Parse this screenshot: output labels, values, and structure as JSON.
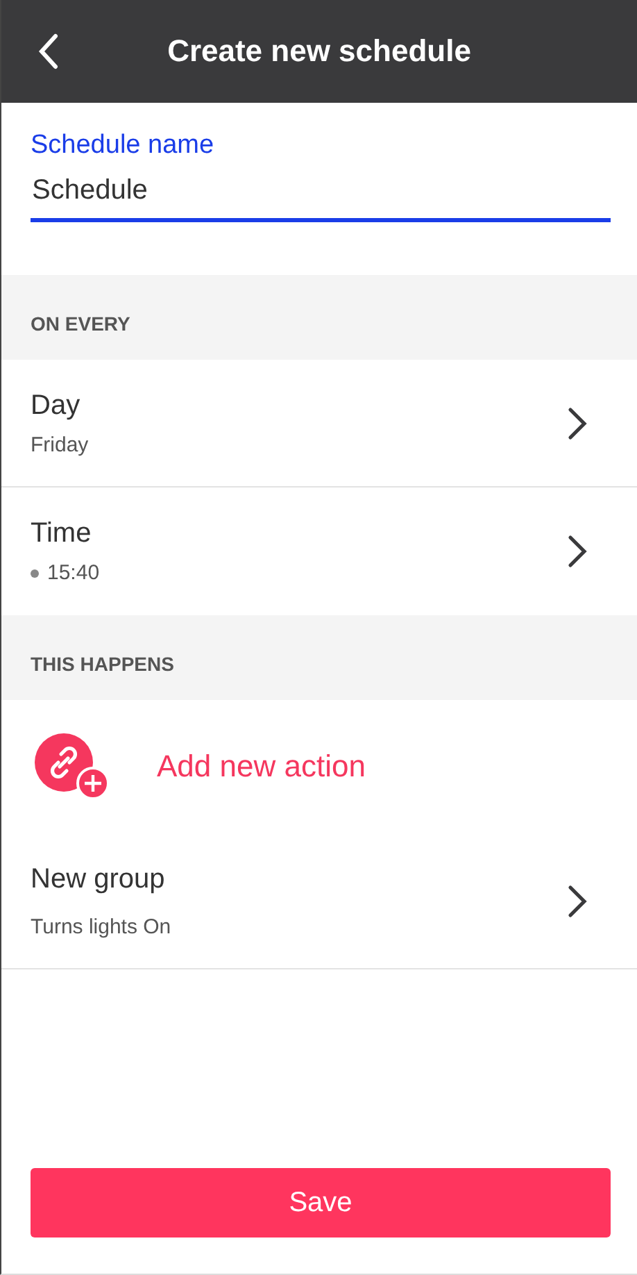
{
  "header": {
    "title": "Create new schedule"
  },
  "name_field": {
    "label": "Schedule name",
    "value": "Schedule"
  },
  "sections": [
    {
      "title": "ON EVERY",
      "items": [
        {
          "kind": "setting",
          "label": "Day",
          "value": "Friday"
        },
        {
          "kind": "time",
          "label": "Time",
          "value": "15:40"
        }
      ]
    },
    {
      "title": "THIS HAPPENS",
      "items": [
        {
          "kind": "add",
          "label": "Add new action"
        },
        {
          "kind": "action",
          "label": "New group",
          "value": "Turns lights On"
        }
      ]
    }
  ],
  "save_button": "Save"
}
